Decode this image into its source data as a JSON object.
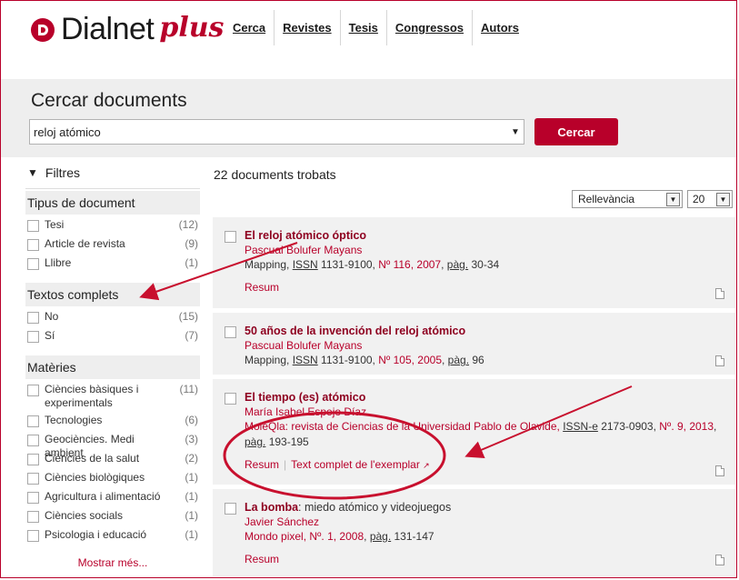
{
  "header": {
    "logo_word": "Dialnet",
    "logo_plus": "plus",
    "nav": [
      {
        "label": "Cerca"
      },
      {
        "label": "Revistes"
      },
      {
        "label": "Tesis"
      },
      {
        "label": "Congressos"
      },
      {
        "label": "Autors"
      }
    ]
  },
  "search": {
    "title": "Cercar documents",
    "value": "reloj atómico",
    "button": "Cercar"
  },
  "filters": {
    "heading": "Filtres",
    "facets": [
      {
        "title": "Tipus de document",
        "items": [
          {
            "label": "Tesi",
            "count": "(12)"
          },
          {
            "label": "Article de revista",
            "count": "(9)"
          },
          {
            "label": "Llibre",
            "count": "(1)"
          }
        ]
      },
      {
        "title": "Textos complets",
        "items": [
          {
            "label": "No",
            "count": "(15)"
          },
          {
            "label": "Sí",
            "count": "(7)"
          }
        ]
      },
      {
        "title": "Matèries",
        "items": [
          {
            "label": "Ciències bàsiques i experimentals",
            "count": "(11)"
          },
          {
            "label": "Tecnologies",
            "count": "(6)"
          },
          {
            "label": "Geociències. Medi ambient",
            "count": "(3)"
          },
          {
            "label": "Ciències de la salut",
            "count": "(2)"
          },
          {
            "label": "Ciències biològiques",
            "count": "(1)"
          },
          {
            "label": "Agricultura i alimentació",
            "count": "(1)"
          },
          {
            "label": "Ciències socials",
            "count": "(1)"
          },
          {
            "label": "Psicologia i educació",
            "count": "(1)"
          }
        ]
      }
    ],
    "more": "Mostrar més..."
  },
  "results": {
    "count_text": "22 documents trobats",
    "sort": "Rellevància",
    "per_page": "20",
    "items": [
      {
        "title": "El reloj atómico óptico",
        "author": "Pascual Bolufer Mayans",
        "source_pre": "Mapping, ",
        "issn_label": "ISSN",
        "issn": " 1131-9100, ",
        "issue": "Nº 116, 2007",
        "pag_sep": ", ",
        "pag_label": "pàg.",
        "pages": " 30-34",
        "links": [
          "Resum"
        ]
      },
      {
        "title": "50 años de la invención del reloj atómico",
        "author": "Pascual Bolufer Mayans",
        "source_pre": "Mapping, ",
        "issn_label": "ISSN",
        "issn": " 1131-9100, ",
        "issue": "Nº 105, 2005",
        "pag_sep": ", ",
        "pag_label": "pàg.",
        "pages": " 96",
        "links": []
      },
      {
        "title": "El tiempo (es) atómico",
        "author": "María Isabel Espejo Díaz",
        "source_pre": "MoleQla: revista de Ciencias de la Universidad Pablo de Olavide, ",
        "issn_label": "ISSN-e",
        "issn": " 2173-0903, ",
        "issue": "Nº. 9, 2013",
        "pag_sep": ", ",
        "pag_label": "pàg.",
        "pages": " 193-195",
        "links": [
          "Resum",
          "Text complet de l'exemplar"
        ]
      },
      {
        "title": "La bomba",
        "title_rest": ": miedo atómico y videojuegos",
        "author": "Javier Sánchez",
        "source_pre": "Mondo pixel, ",
        "issue": "Nº. 1, 2008",
        "pag_sep": ", ",
        "pag_label": "pàg.",
        "pages": " 131-147",
        "links": [
          "Resum"
        ]
      }
    ]
  },
  "colors": {
    "accent": "#b8002a",
    "annotation": "#c8102e",
    "band": "#eeeeee"
  }
}
